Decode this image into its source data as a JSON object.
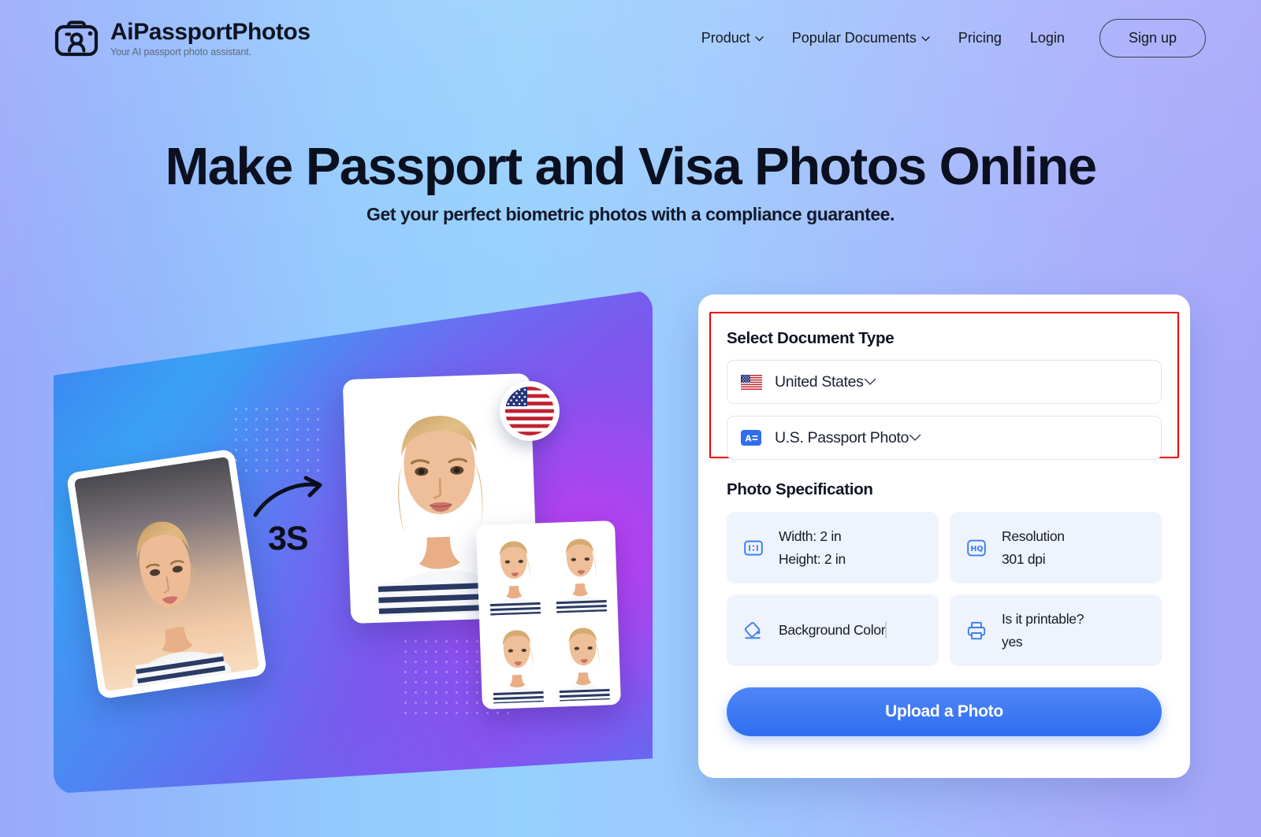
{
  "brand": {
    "name": "AiPassportPhotos",
    "tagline": "Your AI passport photo assistant.",
    "logo_icon": "camera-portrait-icon"
  },
  "nav": {
    "items": [
      {
        "label": "Product",
        "has_dropdown": true
      },
      {
        "label": "Popular Documents",
        "has_dropdown": true
      },
      {
        "label": "Pricing",
        "has_dropdown": false
      },
      {
        "label": "Login",
        "has_dropdown": false
      }
    ],
    "signup_label": "Sign up"
  },
  "hero": {
    "title": "Make Passport and Visa Photos Online",
    "subtitle": "Get your perfect biometric photos with a compliance guarantee.",
    "illustration": {
      "duration_label": "3S",
      "arrow_icon": "curved-arrow-icon",
      "flag_badge_icon": "us-flag-icon"
    }
  },
  "form": {
    "document_type": {
      "title": "Select Document Type",
      "country": {
        "value": "United States",
        "icon": "us-flag-icon",
        "chevron": "chevron-down-icon"
      },
      "document": {
        "value": "U.S. Passport Photo",
        "icon": "id-card-icon",
        "chevron": "chevron-down-icon"
      }
    },
    "photo_specification": {
      "title": "Photo Specification",
      "cards": [
        {
          "icon": "aspect-ratio-icon",
          "lines": [
            "Width: 2 in",
            "Height: 2 in"
          ],
          "has_swatch": false
        },
        {
          "icon": "hq-resolution-icon",
          "lines": [
            "Resolution",
            "301 dpi"
          ],
          "has_swatch": false
        },
        {
          "icon": "paint-bucket-icon",
          "lines": [
            "Background Color"
          ],
          "has_swatch": true,
          "swatch_color": "#ffffff"
        },
        {
          "icon": "printer-icon",
          "lines": [
            "Is it printable?",
            "yes"
          ],
          "has_swatch": false
        }
      ]
    },
    "upload_label": "Upload a Photo"
  },
  "annotation": {
    "highlight_color": "#ee0000",
    "target": "Select Document Type section"
  },
  "colors": {
    "accent_blue": "#2f6ef0",
    "icon_blue": "#3b7df0",
    "spec_card_bg": "#eef3fd",
    "text_dark": "#0f1422"
  }
}
